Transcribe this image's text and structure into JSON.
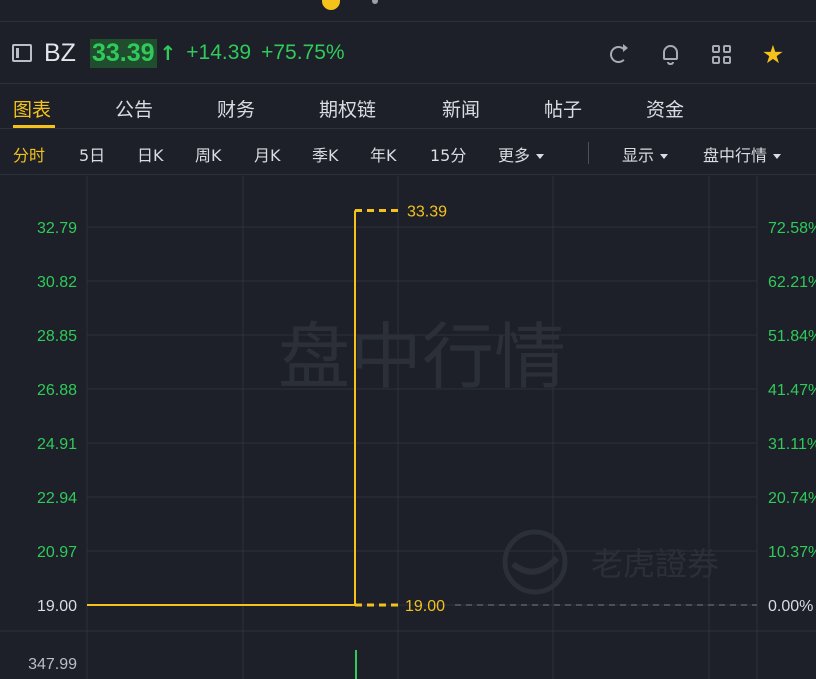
{
  "header": {
    "symbol": "BZ",
    "price": "33.39",
    "price_arrow": "↑",
    "change": "+14.39",
    "change_pct": "+75.75%",
    "icons": [
      "panel-icon",
      "refresh-icon",
      "bell-icon",
      "grid-icon",
      "star-icon",
      "panel-icon"
    ]
  },
  "tabs": [
    {
      "label": "图表",
      "active": true
    },
    {
      "label": "公告"
    },
    {
      "label": "财务"
    },
    {
      "label": "期权链"
    },
    {
      "label": "新闻"
    },
    {
      "label": "帖子"
    },
    {
      "label": "资金"
    }
  ],
  "periods": [
    {
      "label": "分时",
      "active": true
    },
    {
      "label": "5日"
    },
    {
      "label": "日K"
    },
    {
      "label": "周K"
    },
    {
      "label": "月K"
    },
    {
      "label": "季K"
    },
    {
      "label": "年K"
    },
    {
      "label": "15分"
    },
    {
      "label": "更多",
      "dropdown": true
    },
    {
      "label": "显示",
      "dropdown": true
    },
    {
      "label": "盘中行情",
      "dropdown": true
    }
  ],
  "colors": {
    "accent": "#f4c21b",
    "up": "#2fca5a",
    "background": "#1d2028",
    "grid": "#2c313b"
  },
  "chart_data": {
    "type": "line",
    "watermark": "盘中行情",
    "brand_watermark": "老虎證券",
    "y_left_ticks": [
      "32.79",
      "30.82",
      "28.85",
      "26.88",
      "24.91",
      "22.94",
      "20.97",
      "19.00"
    ],
    "y_right_ticks": [
      "72.58%",
      "62.21%",
      "51.84%",
      "41.47%",
      "31.11%",
      "20.74%",
      "10.37%",
      "0.00%"
    ],
    "y_range": [
      19.0,
      33.39
    ],
    "reference_price": 19.0,
    "high_label": "33.39",
    "low_label": "19.00",
    "volume_label": "347.99",
    "series": [
      {
        "points": [
          {
            "t": 0.0,
            "price": 19.0
          },
          {
            "t": 0.4,
            "price": 19.0
          },
          {
            "t": 0.4,
            "price": 33.39
          }
        ]
      }
    ]
  }
}
